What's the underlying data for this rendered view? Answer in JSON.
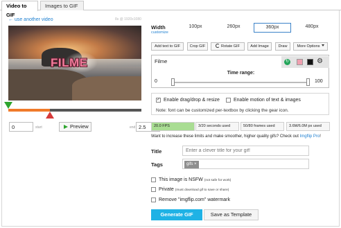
{
  "tabs": [
    {
      "label": "Video to GIF",
      "active": true
    },
    {
      "label": "Images to GIF",
      "active": false
    }
  ],
  "left": {
    "back_link": "← use another video",
    "video_meta": "8s @ 1920x1080",
    "overlay_text": "FILME",
    "trim_range": {
      "start_fraction": 0.0,
      "end_fraction": 0.31
    },
    "start_value": "0",
    "start_label": "start",
    "preview_label": "Preview",
    "end_label": "end",
    "end_value": "2.5"
  },
  "width": {
    "label": "Width",
    "customize": "customize",
    "options": [
      "100px",
      "260px",
      "360px",
      "480px"
    ],
    "selected": "360px"
  },
  "toolbar": {
    "add_text": "Add text to GIF",
    "crop": "Crop GIF",
    "rotate": "Rotate GIF",
    "add_image": "Add Image",
    "draw": "Draw",
    "more": "More Options"
  },
  "text_layer": {
    "text": "Filme",
    "fill_color": "#f0a0b0",
    "outline_color": "#111111",
    "time_range_label": "Time range:",
    "time_min": "0",
    "time_max": "100"
  },
  "options": {
    "drag_drop": {
      "label": "Enable drag/drop & resize",
      "checked": true
    },
    "motion": {
      "label": "Enable motion of text & images",
      "checked": false
    },
    "note": "Note: font can be customized per-textbox by clicking the gear icon."
  },
  "stats": {
    "fps": "20.0 FPS",
    "seconds": "3/20 seconds used",
    "frames": "50/80 frames used",
    "size": "3.6M/6.0M px used"
  },
  "limits": {
    "text": "Want to increase these limits and make smoother, higher quality gifs? Check out ",
    "link": "Imgflip Pro",
    "suffix": "!"
  },
  "form": {
    "title_label": "Title",
    "title_placeholder": "Enter a clever title for your gif!",
    "tags_label": "Tags",
    "tag": "gifs ×"
  },
  "checks": {
    "nsfw_label": "This image is NSFW",
    "nsfw_sub": "(not safe for work)",
    "private_label": "Private",
    "private_sub": "(must download gif to save or share)",
    "watermark_label": "Remove \"imgflip.com\" watermark"
  },
  "actions": {
    "generate": "Generate GIF",
    "template": "Save as Template"
  },
  "colors": {
    "accent": "#1fb2e5",
    "link": "#1d7fd0",
    "fps_bg": "#a9dd93",
    "range": "#f07a2a"
  }
}
